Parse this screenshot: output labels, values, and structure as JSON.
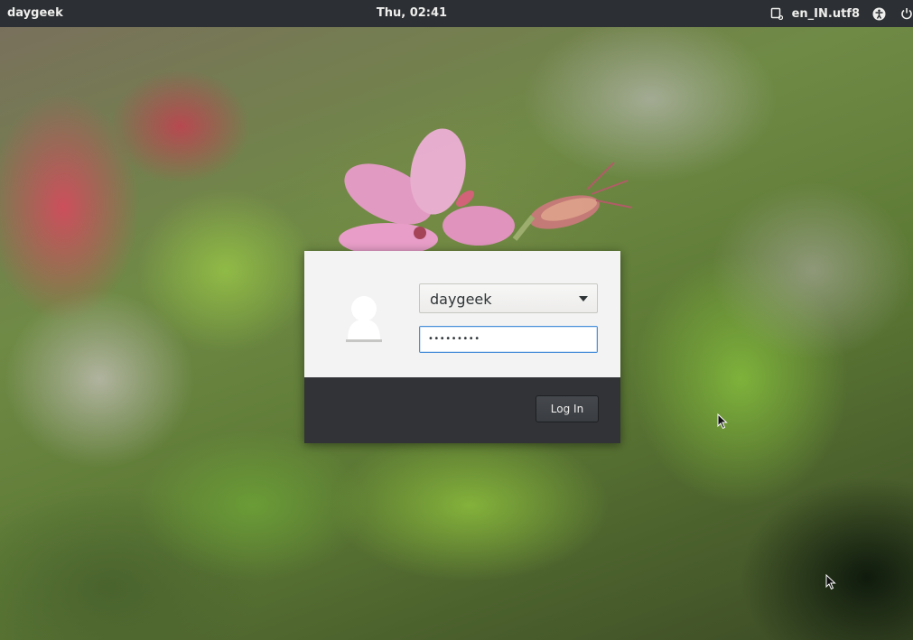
{
  "topbar": {
    "hostname": "daygeek",
    "clock": "Thu, 02:41",
    "locale": "en_IN.utf8",
    "icons": [
      "keyboard-layout-icon",
      "accessibility-icon",
      "power-icon"
    ]
  },
  "login": {
    "username": "daygeek",
    "password_mask": "•••••••••",
    "login_button": "Log In"
  },
  "colors": {
    "topbar_bg": "#2c2f33",
    "dialog_top_bg": "#f3f3f3",
    "dialog_bottom_bg": "#313337",
    "focus_border": "#4a90d9"
  }
}
